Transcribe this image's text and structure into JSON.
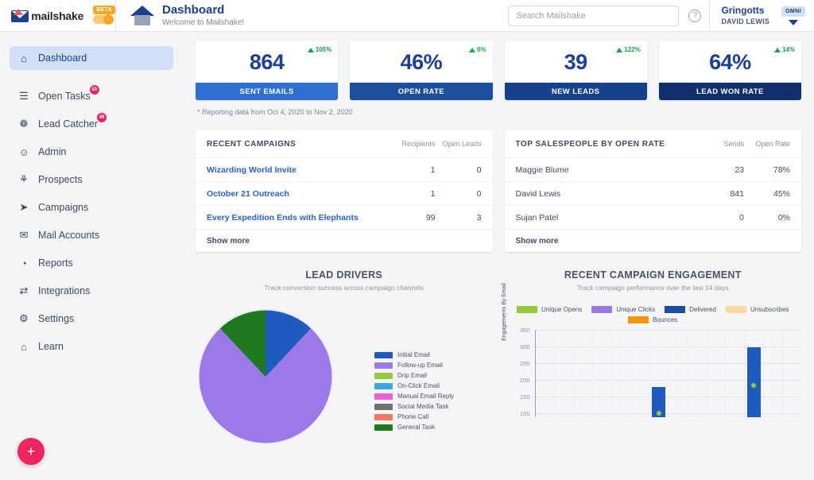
{
  "topbar": {
    "brand_name": "mailshake",
    "beta_label": "BETA",
    "page_title": "Dashboard",
    "page_subtitle": "Welcome to Mailshake!",
    "search_placeholder": "Search Mailshake",
    "help_glyph": "?",
    "account_org": "Gringotts",
    "account_user": "DAVID LEWIS",
    "omni_badge": "OMNI"
  },
  "sidebar": {
    "items": [
      {
        "label": "Dashboard",
        "icon": "home-icon",
        "glyph": "⌂",
        "active": true,
        "badge": ""
      },
      {
        "label": "Open Tasks",
        "icon": "list-icon",
        "glyph": "☰",
        "active": false,
        "badge": "53"
      },
      {
        "label": "Lead Catcher",
        "icon": "lead-catcher-icon",
        "glyph": "❁",
        "active": false,
        "badge": "49"
      },
      {
        "label": "Admin",
        "icon": "admin-user-icon",
        "glyph": "☺",
        "active": false,
        "badge": ""
      },
      {
        "label": "Prospects",
        "icon": "prospects-icon",
        "glyph": "⚘",
        "active": false,
        "badge": ""
      },
      {
        "label": "Campaigns",
        "icon": "paper-plane-icon",
        "glyph": "➤",
        "active": false,
        "badge": ""
      },
      {
        "label": "Mail Accounts",
        "icon": "mail-accounts-icon",
        "glyph": "✉",
        "active": false,
        "badge": ""
      },
      {
        "label": "Reports",
        "icon": "reports-icon",
        "glyph": "◔",
        "active": false,
        "badge": ""
      },
      {
        "label": "Integrations",
        "icon": "integrations-icon",
        "glyph": "⇄",
        "active": false,
        "badge": ""
      },
      {
        "label": "Settings",
        "icon": "gear-icon",
        "glyph": "⚙",
        "active": false,
        "badge": ""
      },
      {
        "label": "Learn",
        "icon": "learn-icon",
        "glyph": "⌂",
        "active": false,
        "badge": ""
      }
    ],
    "fab_label": "+"
  },
  "kpis": [
    {
      "value": "864",
      "label": "SENT EMAILS",
      "delta": "105%",
      "bar_color": "#2f6fd0"
    },
    {
      "value": "46%",
      "label": "OPEN RATE",
      "delta": "6%",
      "bar_color": "#1c4e9e"
    },
    {
      "value": "39",
      "label": "NEW LEADS",
      "delta": "122%",
      "bar_color": "#16418c"
    },
    {
      "value": "64%",
      "label": "LEAD WON RATE",
      "delta": "14%",
      "bar_color": "#10306e"
    }
  ],
  "reporting_note": "* Reporting data from Oct 4, 2020 to Nov 2, 2020",
  "recent_campaigns": {
    "title": "RECENT CAMPAIGNS",
    "columns": [
      "Recipients",
      "Open Leads"
    ],
    "rows": [
      {
        "name": "Wizarding World Invite",
        "recipients": "1",
        "open_leads": "0"
      },
      {
        "name": "October 21 Outreach",
        "recipients": "1",
        "open_leads": "0"
      },
      {
        "name": "Every Expedition Ends with Elephants",
        "recipients": "99",
        "open_leads": "3"
      }
    ],
    "show_more": "Show more"
  },
  "top_salespeople": {
    "title": "TOP SALESPEOPLE BY OPEN RATE",
    "columns": [
      "Sends",
      "Open Rate"
    ],
    "rows": [
      {
        "name": "Maggie Blume",
        "sends": "23",
        "open_rate": "78%"
      },
      {
        "name": "David Lewis",
        "sends": "841",
        "open_rate": "45%"
      },
      {
        "name": "Sujan Patel",
        "sends": "0",
        "open_rate": "0%"
      }
    ],
    "show_more": "Show more"
  },
  "chart_data": [
    {
      "type": "pie",
      "title": "LEAD DRIVERS",
      "subtitle": "Track conversion success across campaign channels",
      "categories": [
        "Initial Email",
        "Follow-up Email",
        "Drip Email",
        "On-Click Email",
        "Manual Email Reply",
        "Social Media Task",
        "Phone Call",
        "General Task"
      ],
      "values": [
        12,
        76,
        0,
        0,
        0,
        0,
        0,
        12
      ],
      "colors": [
        "#1f5bbf",
        "#9b7ae8",
        "#96ca3c",
        "#3aa8dd",
        "#ec5fd6",
        "#6f6f6f",
        "#f2795c",
        "#1d7a21"
      ],
      "legend_position": "right"
    },
    {
      "type": "bar",
      "title": "RECENT CAMPAIGN ENGAGEMENT",
      "subtitle": "Track campaign performance over the last 14 days",
      "ylabel": "Engagements By Email",
      "xlabel": "",
      "ylim": [
        100,
        350
      ],
      "yticks": [
        "350",
        "300",
        "250",
        "200",
        "150",
        "100"
      ],
      "grid": true,
      "legend_position": "top",
      "series": [
        {
          "name": "Unique Opens",
          "color": "#96ca3c",
          "values": [
            0,
            0,
            0,
            0,
            0,
            0,
            112,
            0,
            0,
            0,
            0,
            192,
            0,
            0
          ]
        },
        {
          "name": "Unique Clicks",
          "color": "#9b7ae8",
          "values": [
            0,
            0,
            0,
            0,
            0,
            0,
            0,
            0,
            0,
            0,
            0,
            0,
            0,
            0
          ]
        },
        {
          "name": "Delivered",
          "color": "#1c4e9e",
          "values": [
            0,
            0,
            0,
            0,
            0,
            0,
            187,
            0,
            0,
            0,
            0,
            300,
            0,
            0
          ]
        },
        {
          "name": "Unsubscribes",
          "color": "#fcd9a0",
          "values": [
            0,
            0,
            0,
            0,
            0,
            0,
            0,
            0,
            0,
            0,
            0,
            0,
            0,
            0
          ]
        },
        {
          "name": "Bounces",
          "color": "#f89406",
          "values": [
            0,
            0,
            0,
            0,
            0,
            0,
            0,
            0,
            0,
            0,
            0,
            0,
            0,
            0
          ]
        }
      ]
    }
  ]
}
